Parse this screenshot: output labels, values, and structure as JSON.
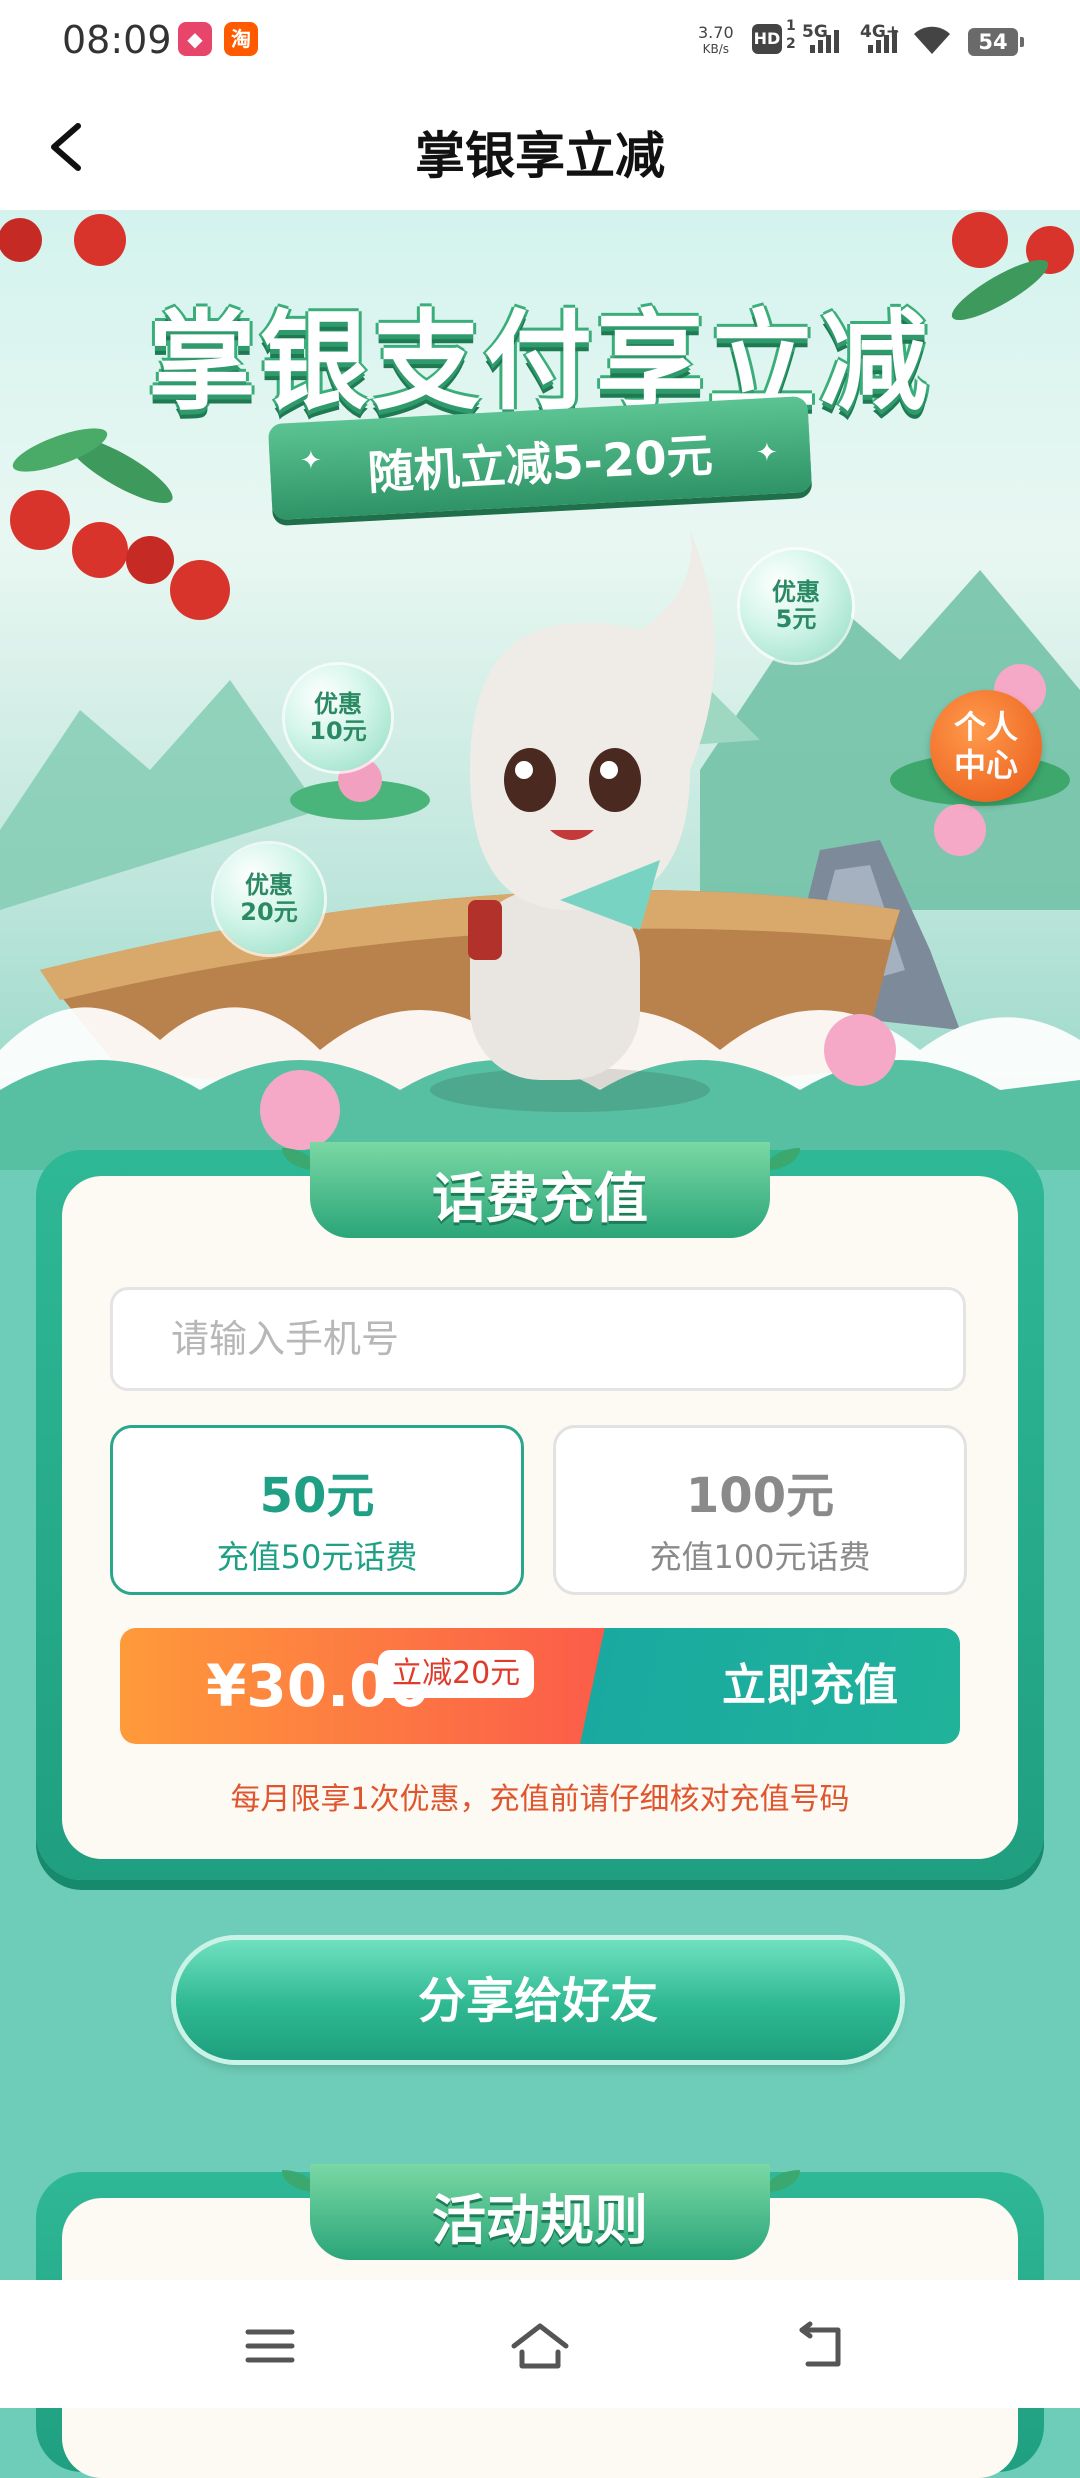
{
  "status_bar": {
    "time": "08:09",
    "net_speed_value": "3.70",
    "net_speed_unit": "KB/s",
    "hd_badge": "HD",
    "sim1": "1",
    "sim2": "2",
    "signal_5g": "5G",
    "signal_4g": "4G+",
    "battery": "54",
    "icons": [
      "notification-app-icon",
      "taobao-app-icon",
      "hd-volte-icon",
      "signal-icon",
      "wifi-icon",
      "battery-icon"
    ]
  },
  "nav": {
    "title": "掌银享立减",
    "back_icon": "back-arrow-icon"
  },
  "banner": {
    "headline": "掌银支付享立减",
    "ribbon": "随机立减5-20元",
    "bubbles": [
      {
        "line1": "优惠",
        "line2": "5元"
      },
      {
        "line1": "优惠",
        "line2": "10元"
      },
      {
        "line1": "优惠",
        "line2": "20元"
      }
    ],
    "personal_center_line1": "个人",
    "personal_center_line2": "中心"
  },
  "recharge": {
    "section_title": "话费充值",
    "phone_placeholder": "请输入手机号",
    "phone_value": "",
    "options": [
      {
        "amount": "50元",
        "desc": "充值50元话费",
        "selected": true
      },
      {
        "amount": "100元",
        "desc": "充值100元话费",
        "selected": false
      }
    ],
    "price": "¥30.00",
    "discount_tag": "立减20元",
    "pay_button": "立即充值",
    "notice": "每月限享1次优惠，充值前请仔细核对充值号码"
  },
  "share_button": "分享给好友",
  "rules": {
    "section_title": "活动规则"
  },
  "system_nav": {
    "icons": [
      "menu-icon",
      "home-icon",
      "back-icon"
    ]
  },
  "colors": {
    "primary_green": "#1f9f80",
    "page_bg": "#6ecdb8",
    "pay_orange": "#ff9a3a",
    "pay_teal": "#1aa9a0",
    "notice_orange": "#e0552d",
    "personal_orange": "#e85818"
  }
}
